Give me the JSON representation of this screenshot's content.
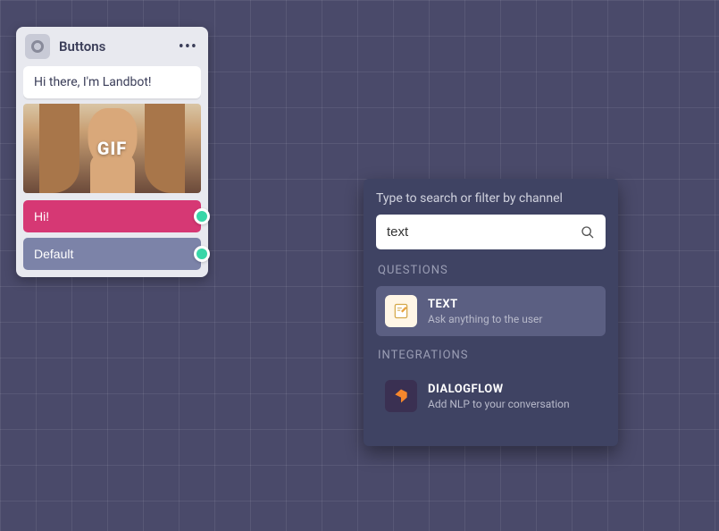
{
  "card": {
    "title": "Buttons",
    "message": "Hi there, I'm Landbot!",
    "gif_label": "GIF",
    "options": [
      {
        "label": "Hi!"
      },
      {
        "label": "Default"
      }
    ]
  },
  "panel": {
    "hint": "Type to search or filter by channel",
    "search_value": "text",
    "sections": [
      {
        "title": "QUESTIONS",
        "items": [
          {
            "title": "TEXT",
            "desc": "Ask anything to the user",
            "selected": true
          }
        ]
      },
      {
        "title": "INTEGRATIONS",
        "items": [
          {
            "title": "DIALOGFLOW",
            "desc": "Add NLP to your conversation",
            "selected": false
          }
        ]
      }
    ]
  }
}
